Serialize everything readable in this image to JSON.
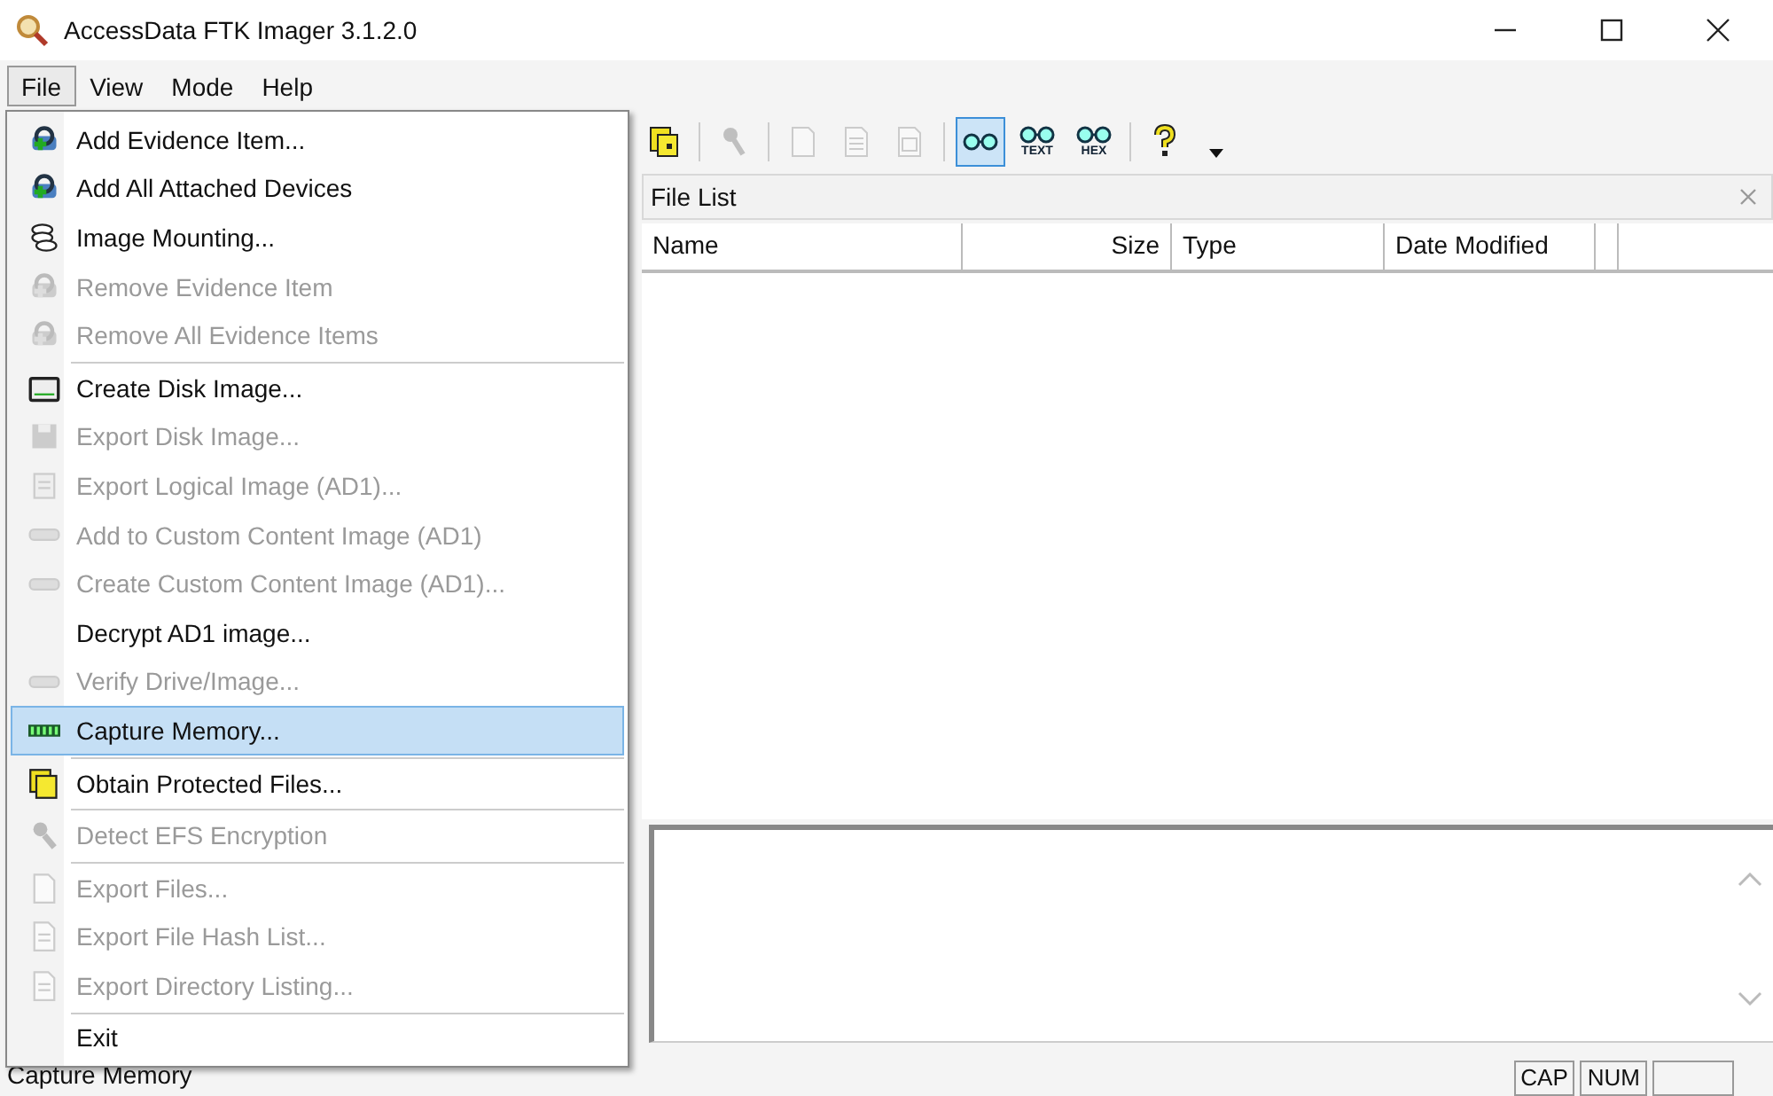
{
  "window": {
    "title": "AccessData FTK Imager 3.1.2.0"
  },
  "menubar": [
    {
      "label": "File",
      "selected": true
    },
    {
      "label": "View",
      "selected": false
    },
    {
      "label": "Mode",
      "selected": false
    },
    {
      "label": "Help",
      "selected": false
    }
  ],
  "menu": {
    "items": [
      {
        "label": "Add Evidence Item...",
        "disabled": false,
        "selected": false,
        "separator_before": false
      },
      {
        "label": "Add All Attached Devices",
        "disabled": false,
        "selected": false,
        "separator_before": false
      },
      {
        "label": "Image Mounting...",
        "disabled": false,
        "selected": false,
        "separator_before": false
      },
      {
        "label": "Remove Evidence Item",
        "disabled": true,
        "selected": false,
        "separator_before": false
      },
      {
        "label": "Remove All Evidence Items",
        "disabled": true,
        "selected": false,
        "separator_before": false
      },
      {
        "label": "Create Disk Image...",
        "disabled": false,
        "selected": false,
        "separator_before": true
      },
      {
        "label": "Export Disk Image...",
        "disabled": true,
        "selected": false,
        "separator_before": false
      },
      {
        "label": "Export Logical Image (AD1)...",
        "disabled": true,
        "selected": false,
        "separator_before": false
      },
      {
        "label": "Add to Custom Content Image (AD1)",
        "disabled": true,
        "selected": false,
        "separator_before": false
      },
      {
        "label": "Create Custom Content Image (AD1)...",
        "disabled": true,
        "selected": false,
        "separator_before": false
      },
      {
        "label": "Decrypt AD1 image...",
        "disabled": false,
        "selected": false,
        "separator_before": false
      },
      {
        "label": "Verify Drive/Image...",
        "disabled": true,
        "selected": false,
        "separator_before": false
      },
      {
        "label": "Capture Memory...",
        "disabled": false,
        "selected": true,
        "separator_before": false
      },
      {
        "label": "Obtain Protected Files...",
        "disabled": false,
        "selected": false,
        "separator_before": true
      },
      {
        "label": "Detect EFS Encryption",
        "disabled": true,
        "selected": false,
        "separator_before": true
      },
      {
        "label": "Export Files...",
        "disabled": true,
        "selected": false,
        "separator_before": true
      },
      {
        "label": "Export File Hash List...",
        "disabled": true,
        "selected": false,
        "separator_before": false
      },
      {
        "label": "Export Directory Listing...",
        "disabled": true,
        "selected": false,
        "separator_before": false
      },
      {
        "label": "Exit",
        "disabled": false,
        "selected": false,
        "separator_before": true
      }
    ]
  },
  "toolbar": {
    "buttons": [
      {
        "kind": "protected",
        "disabled": false,
        "pressed": false
      },
      {
        "kind": "separator"
      },
      {
        "kind": "key",
        "disabled": true,
        "pressed": false
      },
      {
        "kind": "separator"
      },
      {
        "kind": "page",
        "disabled": true,
        "pressed": false
      },
      {
        "kind": "page-lines",
        "disabled": true,
        "pressed": false
      },
      {
        "kind": "page-box",
        "disabled": true,
        "pressed": false
      },
      {
        "kind": "separator"
      },
      {
        "kind": "glasses",
        "disabled": false,
        "pressed": true
      },
      {
        "kind": "glasses",
        "label": "TEXT",
        "disabled": false,
        "pressed": false
      },
      {
        "kind": "glasses",
        "label": "HEX",
        "disabled": false,
        "pressed": false
      },
      {
        "kind": "separator"
      },
      {
        "kind": "help",
        "disabled": false,
        "pressed": false
      },
      {
        "kind": "dropdown"
      }
    ]
  },
  "file_list": {
    "title": "File List",
    "columns": [
      "Name",
      "Size",
      "Type",
      "Date Modified"
    ]
  },
  "status_bar": {
    "text": "Capture Memory",
    "indicators": [
      "CAP",
      "NUM"
    ]
  }
}
